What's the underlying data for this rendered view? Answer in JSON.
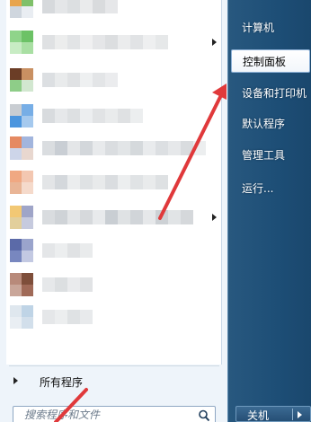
{
  "right_menu": {
    "items": [
      {
        "label": "计算机"
      },
      {
        "label": "控制面板"
      },
      {
        "label": "设备和打印机"
      },
      {
        "label": "默认程序"
      },
      {
        "label": "管理工具"
      },
      {
        "label": "运行..."
      }
    ],
    "shutdown_label": "关机",
    "highlighted_item": "控制面板"
  },
  "left_menu": {
    "all_programs_label": "所有程序",
    "search_placeholder": "搜索程序和文件"
  },
  "colors": {
    "right_pane": "#1d4e76",
    "highlight": "#ffffff",
    "annotation_arrow": "#e0393b"
  },
  "icons": [
    "search-icon",
    "chevron-right-icon",
    "shutdown-arrow-icon"
  ]
}
